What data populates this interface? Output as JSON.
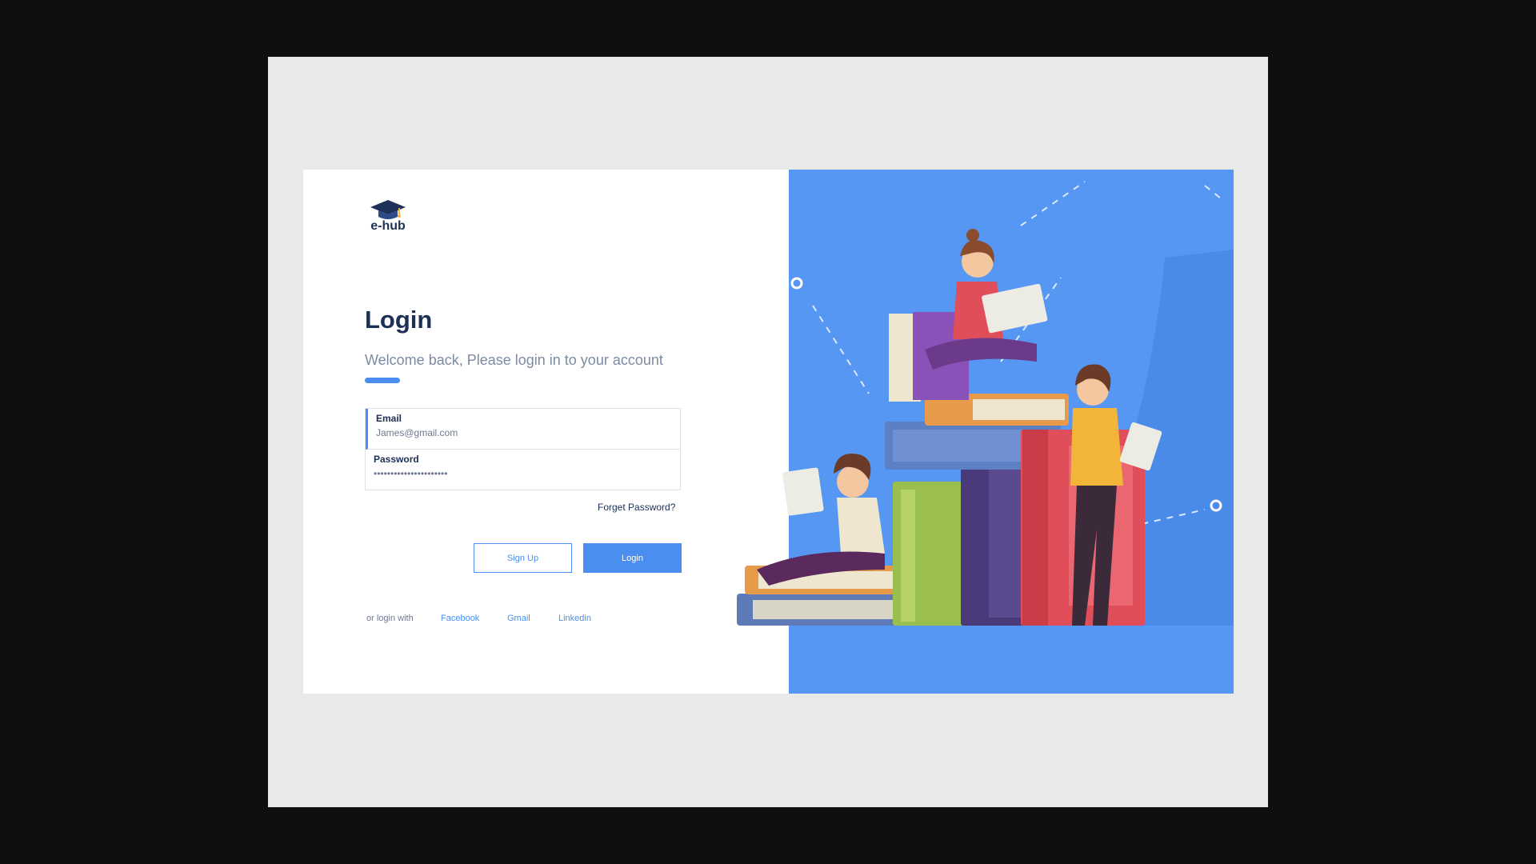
{
  "brand": {
    "name": "e-hub",
    "icon": "graduation-cap-icon"
  },
  "login": {
    "title": "Login",
    "welcome": "Welcome back, Please login in to your account"
  },
  "form": {
    "email": {
      "label": "Email",
      "value": "James@gmail.com"
    },
    "password": {
      "label": "Password",
      "value": "••••••••••••••••••••••"
    },
    "forgot": "Forget Password?"
  },
  "buttons": {
    "signup": "Sign Up",
    "login": "Login"
  },
  "social": {
    "label": "or login with",
    "links": [
      "Facebook",
      "Gmail",
      "Linkedin"
    ]
  },
  "colors": {
    "accent": "#4a8fef",
    "panel": "#5597f3",
    "heading": "#1d2f55",
    "frame": "#e9e9e9",
    "backdrop": "#0e0e0e"
  },
  "illustration": {
    "icon": "students-reading-on-books-illustration"
  }
}
